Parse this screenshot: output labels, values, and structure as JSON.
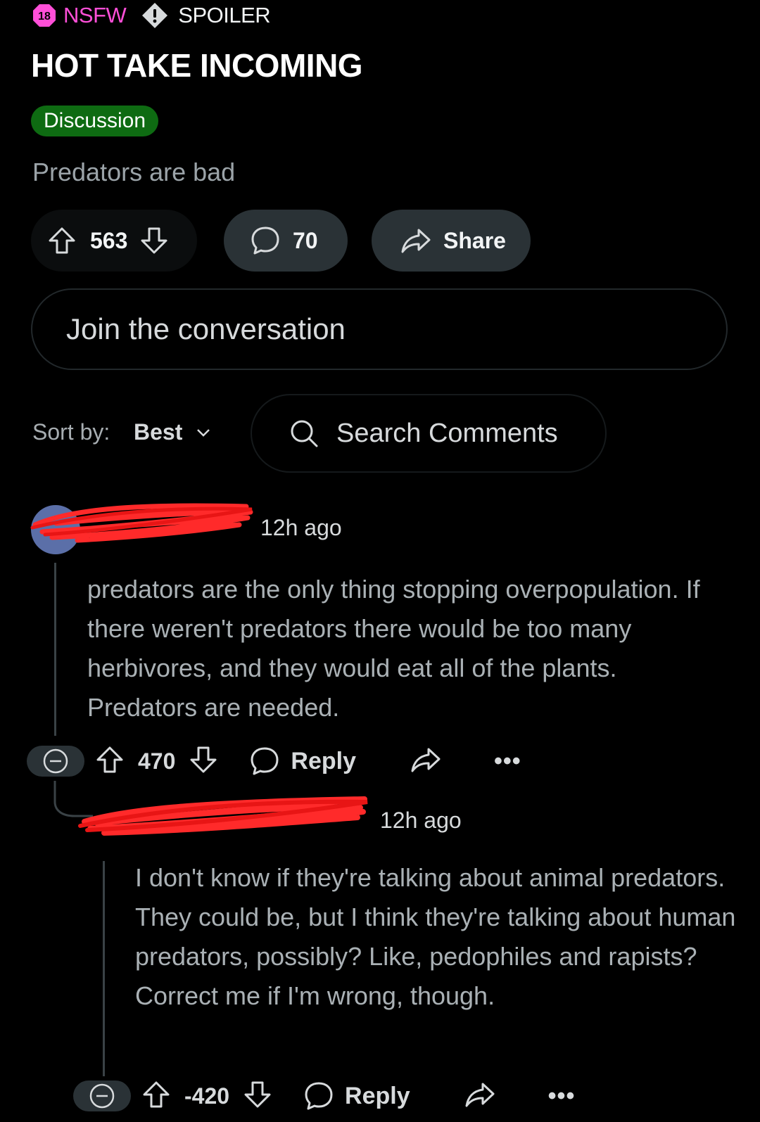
{
  "post": {
    "nsfw_badge_number": "18",
    "nsfw_label": "NSFW",
    "spoiler_label": "SPOILER",
    "title": "HOT TAKE INCOMING",
    "flair": "Discussion",
    "body": "Predators are bad",
    "score": "563",
    "comment_count": "70",
    "share_label": "Share",
    "colors": {
      "nsfw": "#ff4fd8",
      "flair_bg": "#0e6b12",
      "background": "#000000"
    }
  },
  "composer": {
    "placeholder": "Join the conversation"
  },
  "sort": {
    "label": "Sort by:",
    "value": "Best"
  },
  "search": {
    "placeholder": "Search Comments"
  },
  "comments": [
    {
      "username": "[redacted]",
      "time": "12h ago",
      "body": "predators are the only thing stopping overpopulation. If there weren't predators there would be too many herbivores, and they would eat all of the plants. Predators are needed.",
      "score": "470",
      "reply_label": "Reply",
      "more_label": "•••"
    },
    {
      "username": "[redacted]",
      "time": "12h ago",
      "body": "I don't know if they're talking about animal predators. They could be, but I think they're talking about human predators, possibly? Like, pedophiles and rapists? Correct me if I'm wrong, though.",
      "score": "-420",
      "reply_label": "Reply",
      "more_label": "•••"
    }
  ],
  "icons": [
    "nsfw-badge-icon",
    "spoiler-icon",
    "upvote-icon",
    "downvote-icon",
    "comment-icon",
    "share-icon",
    "search-icon",
    "chevron-down-icon",
    "collapse-icon",
    "more-icon"
  ]
}
